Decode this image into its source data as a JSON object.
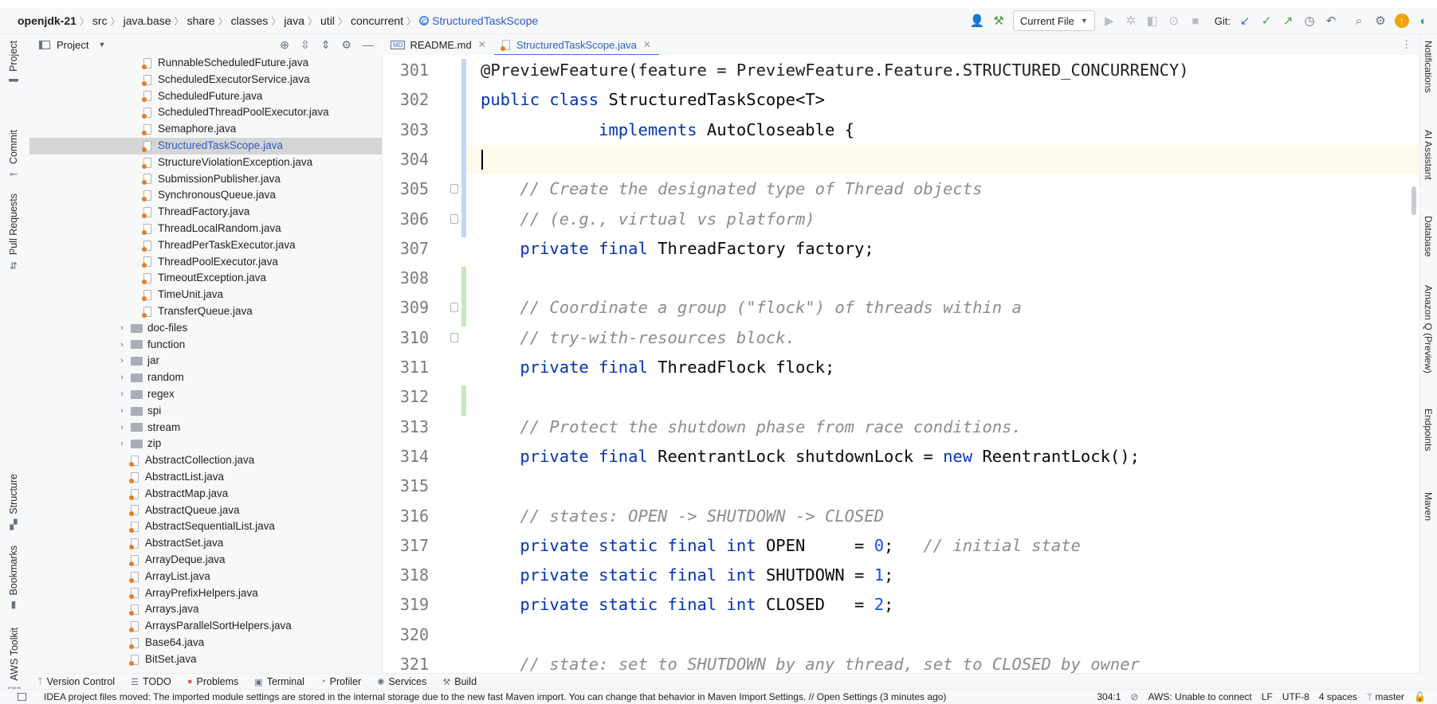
{
  "breadcrumb": {
    "project": "openjdk-21",
    "path": [
      "src",
      "java.base",
      "share",
      "classes",
      "java",
      "util",
      "concurrent"
    ],
    "class": "StructuredTaskScope"
  },
  "toolbar": {
    "run_config": "Current File",
    "git_label": "Git:"
  },
  "left_strip": [
    "Project",
    "Commit",
    "Pull Requests",
    "Structure",
    "Bookmarks",
    "AWS Toolkit"
  ],
  "project_panel": {
    "title": "Project"
  },
  "tree": [
    {
      "label": "RunnableScheduledFuture.java",
      "kind": "file",
      "indent": 2
    },
    {
      "label": "ScheduledExecutorService.java",
      "kind": "file",
      "indent": 2
    },
    {
      "label": "ScheduledFuture.java",
      "kind": "file",
      "indent": 2
    },
    {
      "label": "ScheduledThreadPoolExecutor.java",
      "kind": "file",
      "indent": 2
    },
    {
      "label": "Semaphore.java",
      "kind": "file",
      "indent": 2
    },
    {
      "label": "StructuredTaskScope.java",
      "kind": "file",
      "indent": 2,
      "selected": true
    },
    {
      "label": "StructureViolationException.java",
      "kind": "file",
      "indent": 2
    },
    {
      "label": "SubmissionPublisher.java",
      "kind": "file",
      "indent": 2
    },
    {
      "label": "SynchronousQueue.java",
      "kind": "file",
      "indent": 2
    },
    {
      "label": "ThreadFactory.java",
      "kind": "file",
      "indent": 2
    },
    {
      "label": "ThreadLocalRandom.java",
      "kind": "file",
      "indent": 2
    },
    {
      "label": "ThreadPerTaskExecutor.java",
      "kind": "file",
      "indent": 2
    },
    {
      "label": "ThreadPoolExecutor.java",
      "kind": "file",
      "indent": 2
    },
    {
      "label": "TimeoutException.java",
      "kind": "file",
      "indent": 2
    },
    {
      "label": "TimeUnit.java",
      "kind": "file",
      "indent": 2
    },
    {
      "label": "TransferQueue.java",
      "kind": "file",
      "indent": 2
    },
    {
      "label": "doc-files",
      "kind": "folder",
      "indent": 1
    },
    {
      "label": "function",
      "kind": "folder",
      "indent": 1
    },
    {
      "label": "jar",
      "kind": "folder",
      "indent": 1
    },
    {
      "label": "random",
      "kind": "folder",
      "indent": 1
    },
    {
      "label": "regex",
      "kind": "folder",
      "indent": 1
    },
    {
      "label": "spi",
      "kind": "folder",
      "indent": 1
    },
    {
      "label": "stream",
      "kind": "folder",
      "indent": 1
    },
    {
      "label": "zip",
      "kind": "folder",
      "indent": 1
    },
    {
      "label": "AbstractCollection.java",
      "kind": "file",
      "indent": 1
    },
    {
      "label": "AbstractList.java",
      "kind": "file",
      "indent": 1
    },
    {
      "label": "AbstractMap.java",
      "kind": "file",
      "indent": 1
    },
    {
      "label": "AbstractQueue.java",
      "kind": "file",
      "indent": 1
    },
    {
      "label": "AbstractSequentialList.java",
      "kind": "file",
      "indent": 1
    },
    {
      "label": "AbstractSet.java",
      "kind": "file",
      "indent": 1
    },
    {
      "label": "ArrayDeque.java",
      "kind": "file",
      "indent": 1
    },
    {
      "label": "ArrayList.java",
      "kind": "file",
      "indent": 1
    },
    {
      "label": "ArrayPrefixHelpers.java",
      "kind": "file",
      "indent": 1
    },
    {
      "label": "Arrays.java",
      "kind": "file",
      "indent": 1
    },
    {
      "label": "ArraysParallelSortHelpers.java",
      "kind": "file",
      "indent": 1
    },
    {
      "label": "Base64.java",
      "kind": "file",
      "indent": 1
    },
    {
      "label": "BitSet.java",
      "kind": "file",
      "indent": 1
    }
  ],
  "tabs": [
    {
      "label": "README.md",
      "active": false
    },
    {
      "label": "StructuredTaskScope.java",
      "active": true
    }
  ],
  "code_lines": [
    {
      "n": "301",
      "tokens": [
        [
          "ann",
          "@PreviewFeature(feature = PreviewFeature.Feature.STRUCTURED_CONCURRENCY)"
        ]
      ]
    },
    {
      "n": "302",
      "tokens": [
        [
          "kw",
          "public class "
        ],
        [
          "p",
          "StructuredTaskScope<T>"
        ]
      ]
    },
    {
      "n": "303",
      "tokens": [
        [
          "p",
          "            "
        ],
        [
          "kw",
          "implements "
        ],
        [
          "p",
          "AutoCloseable {"
        ]
      ]
    },
    {
      "n": "304",
      "tokens": [
        [
          "p",
          ""
        ]
      ],
      "current": true
    },
    {
      "n": "305",
      "tokens": [
        [
          "p",
          "    "
        ],
        [
          "cm",
          "// Create the designated type of Thread objects"
        ]
      ]
    },
    {
      "n": "306",
      "tokens": [
        [
          "p",
          "    "
        ],
        [
          "cm",
          "// (e.g., virtual vs platform)"
        ]
      ]
    },
    {
      "n": "307",
      "tokens": [
        [
          "p",
          "    "
        ],
        [
          "kw",
          "private final "
        ],
        [
          "p",
          "ThreadFactory factory;"
        ]
      ]
    },
    {
      "n": "308",
      "tokens": [
        [
          "p",
          ""
        ]
      ]
    },
    {
      "n": "309",
      "tokens": [
        [
          "p",
          "    "
        ],
        [
          "cm",
          "// Coordinate a group (\"flock\") of threads within a"
        ]
      ]
    },
    {
      "n": "310",
      "tokens": [
        [
          "p",
          "    "
        ],
        [
          "cm",
          "// try-with-resources block."
        ]
      ]
    },
    {
      "n": "311",
      "tokens": [
        [
          "p",
          "    "
        ],
        [
          "kw",
          "private final "
        ],
        [
          "p",
          "ThreadFlock flock;"
        ]
      ]
    },
    {
      "n": "312",
      "tokens": [
        [
          "p",
          ""
        ]
      ]
    },
    {
      "n": "313",
      "tokens": [
        [
          "p",
          "    "
        ],
        [
          "cm",
          "// Protect the shutdown phase from race conditions."
        ]
      ]
    },
    {
      "n": "314",
      "tokens": [
        [
          "p",
          "    "
        ],
        [
          "kw",
          "private final "
        ],
        [
          "p",
          "ReentrantLock shutdownLock = "
        ],
        [
          "kw",
          "new "
        ],
        [
          "p",
          "ReentrantLock();"
        ]
      ]
    },
    {
      "n": "315",
      "tokens": [
        [
          "p",
          ""
        ]
      ]
    },
    {
      "n": "316",
      "tokens": [
        [
          "p",
          "    "
        ],
        [
          "cm",
          "// states: OPEN -> SHUTDOWN -> CLOSED"
        ]
      ]
    },
    {
      "n": "317",
      "tokens": [
        [
          "p",
          "    "
        ],
        [
          "kw",
          "private static final int "
        ],
        [
          "p",
          "OPEN     = "
        ],
        [
          "num",
          "0"
        ],
        [
          "p",
          ";   "
        ],
        [
          "cm",
          "// initial state"
        ]
      ]
    },
    {
      "n": "318",
      "tokens": [
        [
          "p",
          "    "
        ],
        [
          "kw",
          "private static final int "
        ],
        [
          "p",
          "SHUTDOWN = "
        ],
        [
          "num",
          "1"
        ],
        [
          "p",
          ";"
        ]
      ]
    },
    {
      "n": "319",
      "tokens": [
        [
          "p",
          "    "
        ],
        [
          "kw",
          "private static final int "
        ],
        [
          "p",
          "CLOSED   = "
        ],
        [
          "num",
          "2"
        ],
        [
          "p",
          ";"
        ]
      ]
    },
    {
      "n": "320",
      "tokens": [
        [
          "p",
          ""
        ]
      ]
    },
    {
      "n": "321",
      "tokens": [
        [
          "p",
          "    "
        ],
        [
          "cm",
          "// state: set to SHUTDOWN by any thread, set to CLOSED by owner"
        ]
      ]
    }
  ],
  "right_strip": [
    "Notifications",
    "AI Assistant",
    "Database",
    "Amazon Q (Preview)",
    "Endpoints",
    "Maven"
  ],
  "bottom_tools": [
    "Version Control",
    "TODO",
    "Problems",
    "Terminal",
    "Profiler",
    "Services",
    "Build"
  ],
  "status": {
    "message": "IDEA project files moved: The imported module settings are stored in the internal storage due to the new fast Maven import. You can change that behavior in Maven Import Settings. // Open Settings (3 minutes ago)",
    "position": "304:1",
    "aws": "AWS: Unable to connect",
    "line_sep": "LF",
    "encoding": "UTF-8",
    "indent": "4 spaces",
    "branch": "master"
  },
  "colors": {
    "keyword": "#0033b3",
    "comment": "#8c8c8c",
    "number": "#1750eb",
    "selection": "#d5d5d5",
    "current_line": "#fdfbec",
    "accent": "#3574f0"
  }
}
